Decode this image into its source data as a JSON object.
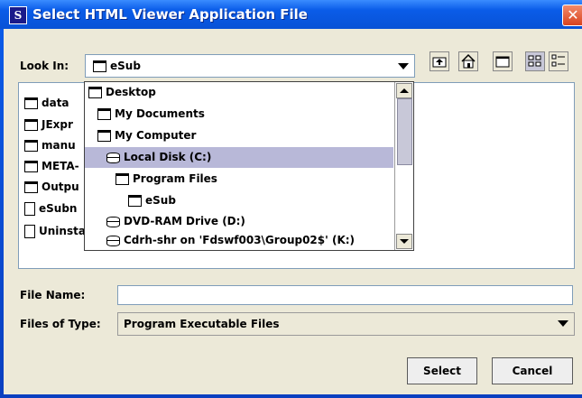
{
  "window": {
    "title": "Select HTML Viewer Application File",
    "icon_letter": "S",
    "close_symbol": "✕"
  },
  "look_in": {
    "label": "Look In:",
    "value": "eSub"
  },
  "dropdown": {
    "items": [
      {
        "label": "Desktop",
        "icon": "folder-icon",
        "indent": 0,
        "selected": false
      },
      {
        "label": "My Documents",
        "icon": "folder-icon",
        "indent": 1,
        "selected": false
      },
      {
        "label": "My Computer",
        "icon": "folder-icon",
        "indent": 1,
        "selected": false
      },
      {
        "label": "Local Disk (C:)",
        "icon": "disk-icon",
        "indent": 2,
        "selected": true
      },
      {
        "label": "Program Files",
        "icon": "folder-icon",
        "indent": 3,
        "selected": false
      },
      {
        "label": "eSub",
        "icon": "folder-icon",
        "indent": 4,
        "selected": false
      },
      {
        "label": "DVD-RAM Drive (D:)",
        "icon": "disk-icon",
        "indent": 2,
        "selected": false
      },
      {
        "label": "Cdrh-shr on 'Fdswf003\\Group02$' (K:)",
        "icon": "disk-icon",
        "indent": 2,
        "selected": false
      }
    ]
  },
  "file_list": {
    "items": [
      {
        "label": "data",
        "icon": "folder-icon"
      },
      {
        "label": "JExpr",
        "icon": "folder-icon"
      },
      {
        "label": "manu",
        "icon": "folder-icon"
      },
      {
        "label": "META-",
        "icon": "folder-icon"
      },
      {
        "label": "Outpu",
        "icon": "folder-icon"
      },
      {
        "label": "eSubn",
        "icon": "file-icon"
      },
      {
        "label": "Uninstall.exe",
        "icon": "file-icon"
      }
    ]
  },
  "file_name": {
    "label": "File Name:",
    "value": ""
  },
  "files_of_type": {
    "label": "Files of Type:",
    "value": "Program Executable Files"
  },
  "buttons": {
    "select": "Select",
    "cancel": "Cancel"
  }
}
